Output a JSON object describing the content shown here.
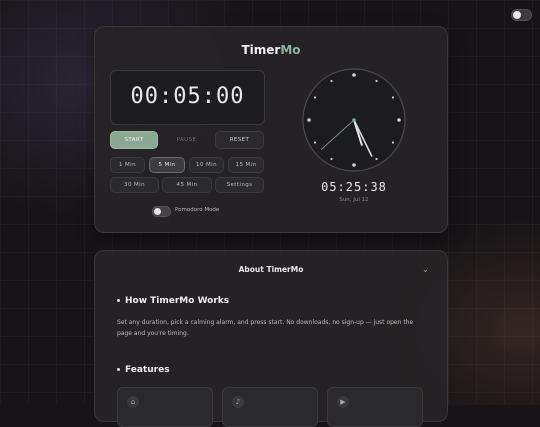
{
  "brand": {
    "name_part1": "Timer",
    "name_part2": "Mo"
  },
  "timer": {
    "display": "00:05:00"
  },
  "controls": {
    "start": "START",
    "pause": "PAUSE",
    "reset": "RESET"
  },
  "presets": [
    {
      "label": "1 Min"
    },
    {
      "label": "5 Min",
      "selected": true
    },
    {
      "label": "10 Min"
    },
    {
      "label": "15 Min"
    },
    {
      "label": "30 Min"
    },
    {
      "label": "45 Min"
    },
    {
      "label": "Settings"
    }
  ],
  "pomodoro": {
    "label": "Pomodoro Mode",
    "enabled": false
  },
  "clock": {
    "time": "05:25:38",
    "date": "Sun, Jul 12",
    "hours": 5,
    "minutes": 25,
    "seconds": 38
  },
  "about": {
    "title": "About TimerMo",
    "how_title": "How TimerMo Works",
    "how_text": "Set any duration, pick a calming alarm, and press start. No downloads, no sign-up — just open the page and you're timing.",
    "features_title": "Features"
  },
  "theme": {
    "accent": "#8aa892",
    "background": "#161416",
    "dark_mode": true
  },
  "icons": {
    "theme_toggle": "toggle-icon",
    "chevron": "chevron-down-icon",
    "features": [
      "home-icon",
      "sound-icon",
      "volume-icon"
    ]
  }
}
